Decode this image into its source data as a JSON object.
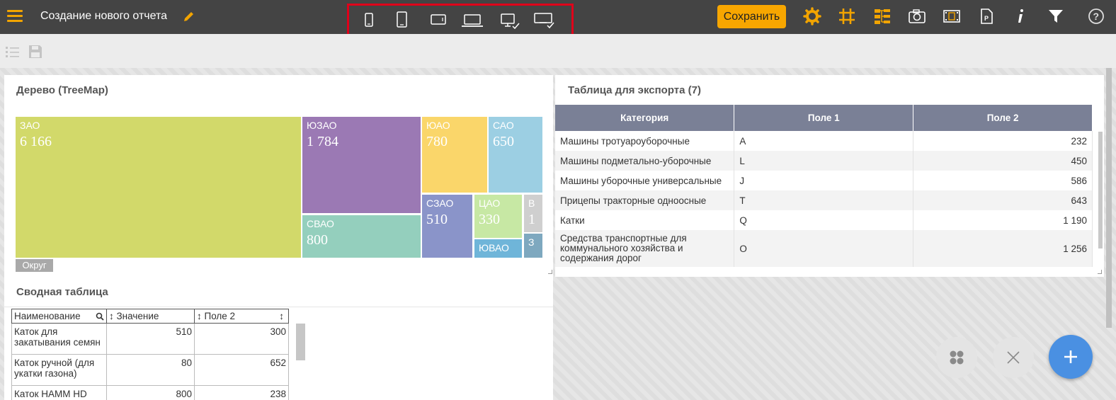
{
  "header": {
    "title": "Создание нового отчета",
    "save_label": "Сохранить",
    "accent": "#f7a600",
    "icons": [
      "menu-icon",
      "edit-icon",
      "mobile-portrait-icon",
      "tablet-portrait-icon",
      "tablet-landscape-icon",
      "laptop-icon",
      "desktop-check-icon",
      "wide-screen-check-icon",
      "settings-icon",
      "grid-hash-icon",
      "tree-structure-icon",
      "camera-icon",
      "film-icon",
      "ppt-export-icon",
      "info-icon",
      "filter-icon",
      "help-icon"
    ]
  },
  "treemap": {
    "title": "Дерево (TreeMap)",
    "legend_label": "Округ",
    "cells": [
      {
        "label": "ЗАО",
        "value": "6 166",
        "color": "#d2d96a"
      },
      {
        "label": "ЮЗАО",
        "value": "1 784",
        "color": "#9b79b4"
      },
      {
        "label": "ЮАО",
        "value": "780",
        "color": "#fad66a"
      },
      {
        "label": "САО",
        "value": "650",
        "color": "#9ccfe3"
      },
      {
        "label": "СВАО",
        "value": "800",
        "color": "#94cfbd"
      },
      {
        "label": "СЗАО",
        "value": "510",
        "color": "#8a94c9"
      },
      {
        "label": "ЦАО",
        "value": "330",
        "color": "#c7e8a4"
      },
      {
        "label": "В",
        "value": "1",
        "color": "#cfcfcf"
      },
      {
        "label": "ЮВАО",
        "value": "",
        "color": "#6fb5d9"
      },
      {
        "label": "З",
        "value": "",
        "color": "#7ea8bf"
      }
    ]
  },
  "export_table": {
    "title": "Таблица для экспорта (7)",
    "columns": [
      "Категория",
      "Поле 1",
      "Поле 2"
    ],
    "rows": [
      {
        "category": "Машины тротуароуборочные",
        "field1": "A",
        "field2": "232"
      },
      {
        "category": "Машины подметально-уборочные",
        "field1": "L",
        "field2": "450"
      },
      {
        "category": "Машины уборочные универсальные",
        "field1": "J",
        "field2": "586"
      },
      {
        "category": "Прицепы тракторные одноосные",
        "field1": "T",
        "field2": "643"
      },
      {
        "category": "Катки",
        "field1": "Q",
        "field2": "1 190"
      },
      {
        "category": "Средства транспортные для коммунального хозяйства и содержания дорог",
        "field1": "O",
        "field2": "1 256"
      }
    ]
  },
  "pivot": {
    "title": "Сводная таблица",
    "columns": [
      "Наименование",
      "↕ Значение",
      "↕ Поле 2",
      "↕"
    ],
    "rows": [
      {
        "name": "Каток для закатывания семян",
        "value": "510",
        "field2": "300"
      },
      {
        "name": "Каток ручной (для укатки газона)",
        "value": "80",
        "field2": "652"
      },
      {
        "name": "Каток HAMM HD",
        "value": "800",
        "field2": "238"
      }
    ]
  }
}
